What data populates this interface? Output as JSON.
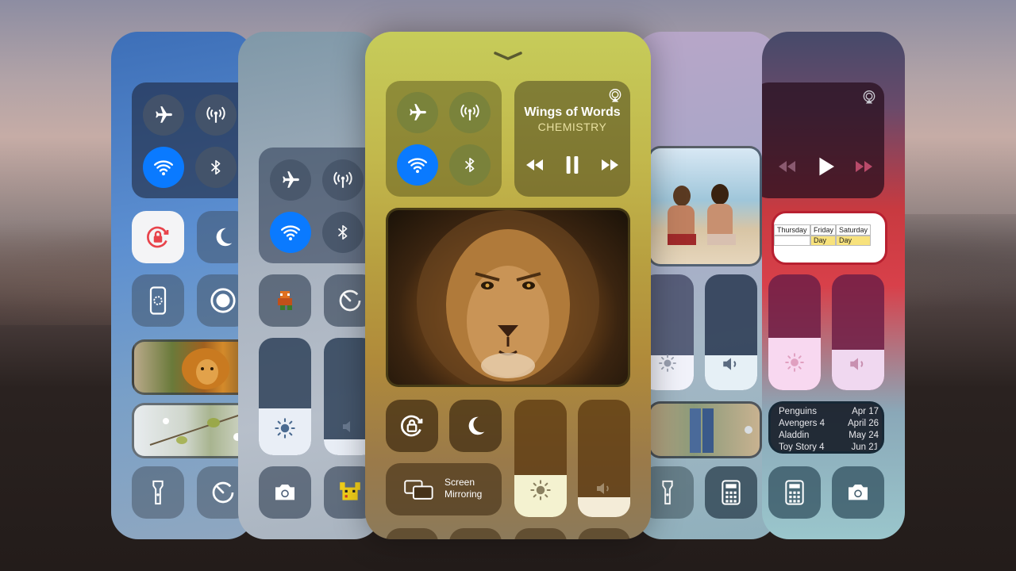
{
  "music": {
    "title": "Wings of Words",
    "artist": "CHEMISTRY"
  },
  "screen_mirroring": {
    "line1": "Screen",
    "line2": "Mirroring"
  },
  "calendar": {
    "days": [
      "Thursday",
      "Friday",
      "Saturday"
    ],
    "row": [
      "",
      "Day",
      "Day"
    ]
  },
  "movies": [
    {
      "name": "Penguins",
      "date": "Apr 17"
    },
    {
      "name": "Avengers 4",
      "date": "April 26"
    },
    {
      "name": "Aladdin",
      "date": "May 24"
    },
    {
      "name": "Toy Story 4",
      "date": "Jun 21"
    }
  ],
  "levels": {
    "center_brightness": 0.36,
    "center_volume": 0.17,
    "left2_brightness": 0.4,
    "right2_brightness": 0.3,
    "right2_volume": 0.3,
    "right1_brightness": 0.45,
    "right1_volume": 0.35
  },
  "colors": {
    "accent_blue": "#0a7aff",
    "lock_red": "#e8434b"
  }
}
